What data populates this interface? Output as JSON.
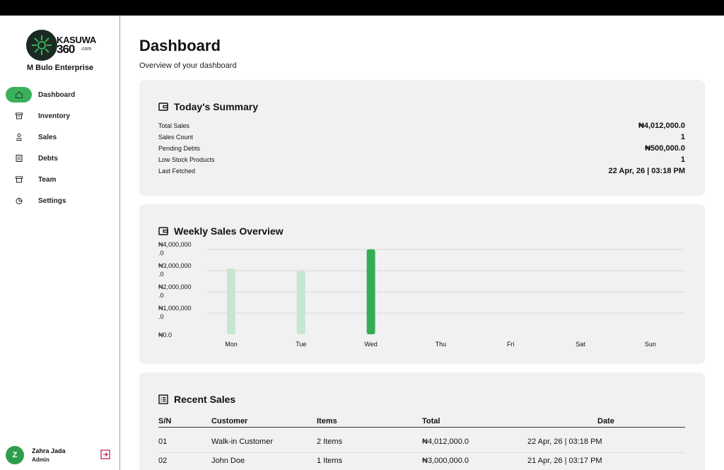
{
  "sidebar": {
    "logo": {
      "line1": "KASUWA",
      "line2": "360",
      "line3": ".com"
    },
    "business_name": "M Bulo Enterprise",
    "nav": [
      {
        "label": "Dashboard",
        "icon": "home-icon",
        "active": true
      },
      {
        "label": "Inventory",
        "icon": "archive-icon",
        "active": false
      },
      {
        "label": "Sales",
        "icon": "sales-icon",
        "active": false
      },
      {
        "label": "Debts",
        "icon": "ledger-icon",
        "active": false
      },
      {
        "label": "Team",
        "icon": "team-icon",
        "active": false
      },
      {
        "label": "Settings",
        "icon": "pie-icon",
        "active": false
      }
    ],
    "user": {
      "initial": "Z",
      "name": "Zahra Jada",
      "role": "Admin"
    }
  },
  "header": {
    "title": "Dashboard",
    "subtitle": "Overview of your dashboard"
  },
  "summary": {
    "title": "Today's Summary",
    "rows": [
      {
        "label": "Total Sales",
        "value": "₦4,012,000.0"
      },
      {
        "label": "Sales Count",
        "value": "1"
      },
      {
        "label": "Pending Debts",
        "value": "₦500,000.0"
      },
      {
        "label": "Low Stock Products",
        "value": "1"
      },
      {
        "label": "Last Fetched",
        "value": "22 Apr, 26 | 03:18 PM"
      }
    ]
  },
  "weekly": {
    "title": "Weekly Sales Overview"
  },
  "chart_data": {
    "type": "bar",
    "categories": [
      "Mon",
      "Tue",
      "Wed",
      "Thu",
      "Fri",
      "Sat",
      "Sun"
    ],
    "values": [
      3100000,
      3000000,
      4012000,
      0,
      0,
      0,
      0
    ],
    "ylim": [
      0,
      4000000
    ],
    "y_ticks": [
      {
        "value": 4000000,
        "line1": "₦4,000,000",
        "line2": ".0"
      },
      {
        "value": 3000000,
        "line1": "₦3,000,000",
        "line2": ".0"
      },
      {
        "value": 2000000,
        "line1": "₦2,000,000",
        "line2": ".0"
      },
      {
        "value": 1000000,
        "line1": "₦1,000,000",
        "line2": ".0"
      },
      {
        "value": 0,
        "line1": "₦0.0",
        "line2": ""
      }
    ],
    "highlight_index": 2,
    "colors": {
      "bar": "#c7e6cf",
      "highlight": "#35ad55",
      "grid": "#d9d9d9"
    },
    "grid": true
  },
  "recent": {
    "title": "Recent Sales",
    "columns": [
      "S/N",
      "Customer",
      "Items",
      "Total",
      "Date"
    ],
    "rows": [
      {
        "sn": "01",
        "customer": "Walk-in Customer",
        "items": "2 Items",
        "total": "₦4,012,000.0",
        "date": "22 Apr, 26 | 03:18 PM"
      },
      {
        "sn": "02",
        "customer": "John Doe",
        "items": "1 Items",
        "total": "₦3,000,000.0",
        "date": "21 Apr, 26 | 03:17 PM"
      }
    ]
  },
  "colors": {
    "accent": "#3ab05a",
    "logout": "#c0245c",
    "sidebar_border": "#7bb89a",
    "card_bg": "#f1f1f1"
  }
}
